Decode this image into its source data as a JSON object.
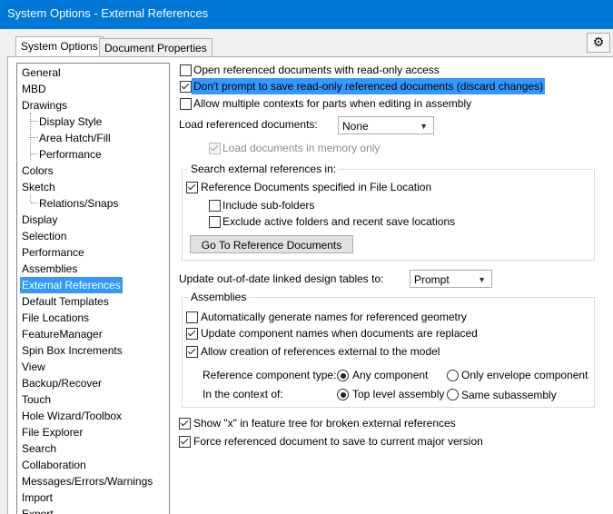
{
  "window": {
    "title": "System Options - External References"
  },
  "tabs": [
    {
      "label": "System Options"
    },
    {
      "label": "Document Properties"
    }
  ],
  "tree": {
    "items": [
      {
        "label": "General",
        "level": 0
      },
      {
        "label": "MBD",
        "level": 0
      },
      {
        "label": "Drawings",
        "level": 0
      },
      {
        "label": "Display Style",
        "level": 1
      },
      {
        "label": "Area Hatch/Fill",
        "level": 1
      },
      {
        "label": "Performance",
        "level": 1
      },
      {
        "label": "Colors",
        "level": 0
      },
      {
        "label": "Sketch",
        "level": 0
      },
      {
        "label": "Relations/Snaps",
        "level": 1
      },
      {
        "label": "Display",
        "level": 0
      },
      {
        "label": "Selection",
        "level": 0
      },
      {
        "label": "Performance",
        "level": 0
      },
      {
        "label": "Assemblies",
        "level": 0
      },
      {
        "label": "External References",
        "level": 0,
        "selected": true
      },
      {
        "label": "Default Templates",
        "level": 0
      },
      {
        "label": "File Locations",
        "level": 0
      },
      {
        "label": "FeatureManager",
        "level": 0
      },
      {
        "label": "Spin Box Increments",
        "level": 0
      },
      {
        "label": "View",
        "level": 0
      },
      {
        "label": "Backup/Recover",
        "level": 0
      },
      {
        "label": "Touch",
        "level": 0
      },
      {
        "label": "Hole Wizard/Toolbox",
        "level": 0
      },
      {
        "label": "File Explorer",
        "level": 0
      },
      {
        "label": "Search",
        "level": 0
      },
      {
        "label": "Collaboration",
        "level": 0
      },
      {
        "label": "Messages/Errors/Warnings",
        "level": 0
      },
      {
        "label": "Import",
        "level": 0
      },
      {
        "label": "Export",
        "level": 0
      }
    ]
  },
  "options": {
    "open_readonly": {
      "label": "Open referenced documents with read-only access",
      "checked": false
    },
    "dont_prompt": {
      "label": "Don't prompt to save read-only referenced documents (discard changes)",
      "checked": true
    },
    "multiple_contexts": {
      "label": "Allow multiple contexts for parts when editing in assembly",
      "checked": false
    },
    "load_referenced": {
      "label": "Load referenced documents:",
      "value": "None"
    },
    "load_in_memory": {
      "label": "Load documents in memory only",
      "checked": true
    }
  },
  "search_group": {
    "legend": "Search external references in:",
    "ref_docs": {
      "label": "Reference Documents specified in File Location",
      "checked": true
    },
    "sub_folders": {
      "label": "Include sub-folders",
      "checked": false
    },
    "exclude_active": {
      "label": "Exclude active folders and recent save locations",
      "checked": false
    },
    "goto_button": "Go To Reference Documents"
  },
  "update_tables": {
    "label": "Update out-of-date linked design tables to:",
    "value": "Prompt"
  },
  "assemblies_group": {
    "legend": "Assemblies",
    "auto_names": {
      "label": "Automatically generate names for referenced geometry",
      "checked": false
    },
    "update_names": {
      "label": "Update component names when documents are replaced",
      "checked": true
    },
    "allow_external": {
      "label": "Allow creation of references external to the model",
      "checked": true
    },
    "ref_type_label": "Reference component type:",
    "any_component": "Any component",
    "only_envelope": "Only envelope component",
    "context_label": "In the context of:",
    "top_level": "Top level assembly",
    "same_sub": "Same subassembly"
  },
  "show_x": {
    "label": "Show \"x\" in feature tree for broken external references",
    "checked": true
  },
  "force_save": {
    "label": "Force referenced document to save to current major version",
    "checked": true
  }
}
